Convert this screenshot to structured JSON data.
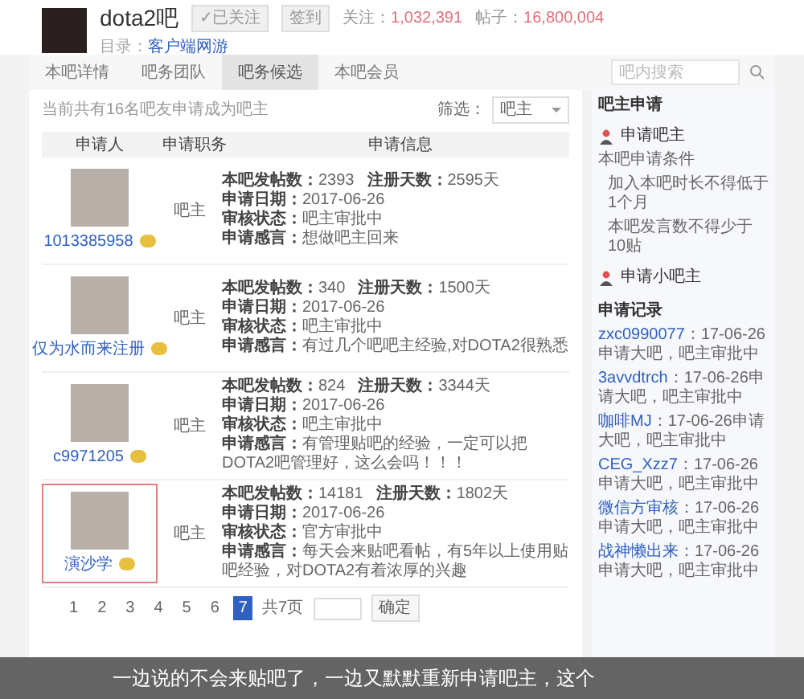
{
  "header": {
    "forum_name": "dota2吧",
    "follow_button": "✓已关注",
    "sign_button": "签到",
    "members_label": "关注：",
    "members": "1,032,391",
    "posts_label": "帖子：",
    "posts": "16,800,004",
    "category_label": "目录：",
    "category": "客户端网游"
  },
  "tabs": [
    {
      "label": "本吧详情",
      "selected": false
    },
    {
      "label": "吧务团队",
      "selected": false
    },
    {
      "label": "吧务候选",
      "selected": true
    },
    {
      "label": "本吧会员",
      "selected": false
    }
  ],
  "search": {
    "placeholder": "吧内搜索"
  },
  "summary": "当前共有16名吧友申请成为吧主",
  "filter": {
    "label": "筛选：",
    "value": "吧主"
  },
  "table": {
    "columns": [
      "申请人",
      "申请职务",
      "申请信息"
    ],
    "rows": [
      {
        "name": "1013385958",
        "role": "吧主",
        "highlighted": false,
        "posts_label": "本吧发帖数：",
        "posts": "2393",
        "days_label": "注册天数：",
        "days": "2595天",
        "date_label": "申请日期：",
        "date": "2017-06-26",
        "status_label": "审核状态：",
        "status": "吧主审批中",
        "note_label": "申请感言：",
        "note": "想做吧主回来"
      },
      {
        "name": "仅为水而来注册",
        "role": "吧主",
        "highlighted": false,
        "posts_label": "本吧发帖数：",
        "posts": "340",
        "days_label": "注册天数：",
        "days": "1500天",
        "date_label": "申请日期：",
        "date": "2017-06-26",
        "status_label": "审核状态：",
        "status": "吧主审批中",
        "note_label": "申请感言：",
        "note": "有过几个吧吧主经验,对DOTA2很熟悉"
      },
      {
        "name": "c9971205",
        "role": "吧主",
        "highlighted": false,
        "posts_label": "本吧发帖数：",
        "posts": "824",
        "days_label": "注册天数：",
        "days": "3344天",
        "date_label": "申请日期：",
        "date": "2017-06-26",
        "status_label": "审核状态：",
        "status": "吧主审批中",
        "note_label": "申请感言：",
        "note": "有管理贴吧的经验，一定可以把DOTA2吧管理好，这么会吗！！！"
      },
      {
        "name": "演沙学",
        "role": "吧主",
        "highlighted": true,
        "posts_label": "本吧发帖数：",
        "posts": "14181",
        "days_label": "注册天数：",
        "days": "1802天",
        "date_label": "申请日期：",
        "date": "2017-06-26",
        "status_label": "审核状态：",
        "status": "官方审批中",
        "note_label": "申请感言：",
        "note": "每天会来贴吧看帖，有5年以上使用贴吧经验，对DOTA2有着浓厚的兴趣"
      }
    ]
  },
  "pagination": {
    "pages": [
      {
        "label": "1",
        "selected": false
      },
      {
        "label": "2",
        "selected": false
      },
      {
        "label": "3",
        "selected": false
      },
      {
        "label": "4",
        "selected": false
      },
      {
        "label": "5",
        "selected": false
      },
      {
        "label": "6",
        "selected": false
      },
      {
        "label": "7",
        "selected": true
      }
    ],
    "total": "共7页",
    "go_button": "确定"
  },
  "sidebar": {
    "title": "吧主申请",
    "apply_link": "申请吧主",
    "conditions_title": "本吧申请条件",
    "conditions": [
      "加入本吧时长不得低于1个月",
      "本吧发言数不得少于10贴"
    ],
    "apply_small_link": "申请小吧主",
    "records_title": "申请记录",
    "records": [
      {
        "user": "zxc0990077",
        "text": "：17-06-26申请大吧，吧主审批中"
      },
      {
        "user": "3avvdtrch",
        "text": "：17-06-26申请大吧，吧主审批中"
      },
      {
        "user": "咖啡MJ",
        "text": "：17-06-26申请大吧，吧主审批中"
      },
      {
        "user": "CEG_Xzz7",
        "text": "：17-06-26申请大吧，吧主审批中"
      },
      {
        "user": "微信方审核",
        "text": "：17-06-26申请大吧，吧主审批中"
      },
      {
        "user": "战神懒出来",
        "text": "：17-06-26申请大吧，吧主审批中"
      }
    ]
  },
  "caption": "一边说的不会来贴吧了，一边又默默重新申请吧主，这个"
}
